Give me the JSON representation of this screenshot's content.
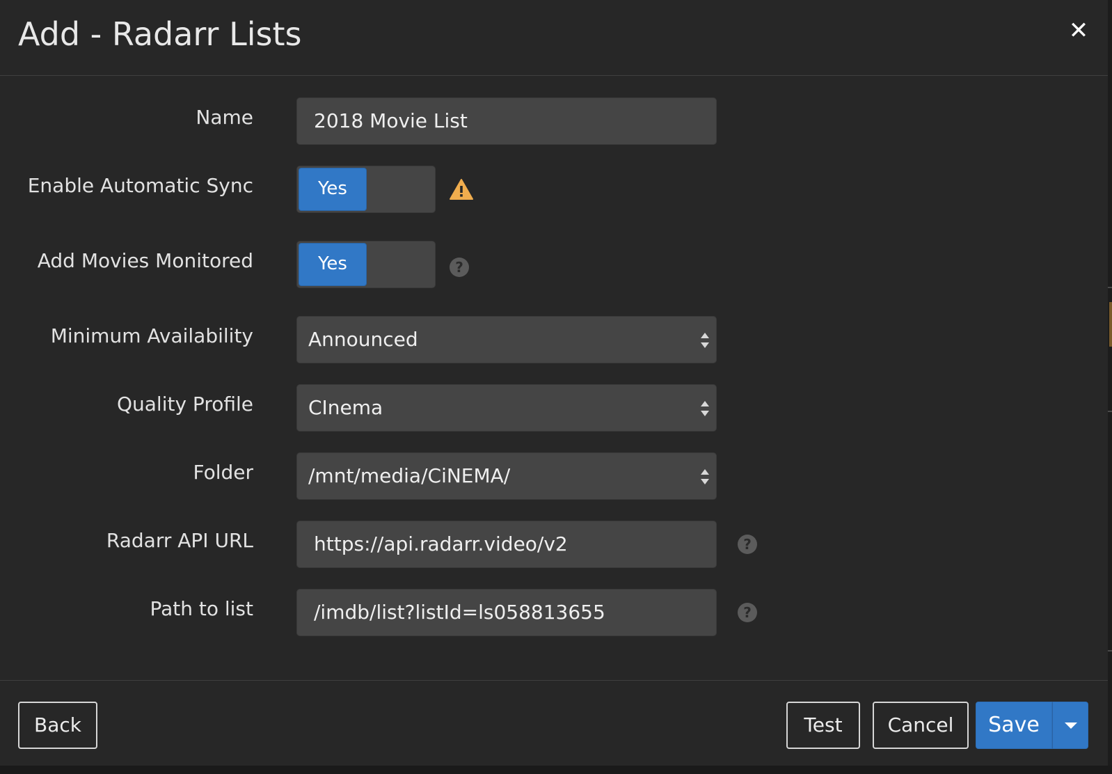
{
  "modal": {
    "title": "Add - Radarr Lists",
    "close_icon": "close-icon"
  },
  "form": {
    "name": {
      "label": "Name",
      "value": "2018 Movie List"
    },
    "enable_automatic_sync": {
      "label": "Enable Automatic Sync",
      "value": "Yes",
      "icon": "warning-icon"
    },
    "add_movies_monitored": {
      "label": "Add Movies Monitored",
      "value": "Yes",
      "icon": "help-icon"
    },
    "minimum_availability": {
      "label": "Minimum Availability",
      "value": "Announced"
    },
    "quality_profile": {
      "label": "Quality Profile",
      "value": "CInema"
    },
    "folder": {
      "label": "Folder",
      "value": "/mnt/media/CiNEMA/"
    },
    "radarr_api_url": {
      "label": "Radarr API URL",
      "value": "https://api.radarr.video/v2",
      "icon": "help-icon"
    },
    "path_to_list": {
      "label": "Path to list",
      "value": "/imdb/list?listId=ls058813655",
      "icon": "help-icon"
    }
  },
  "footer": {
    "back_label": "Back",
    "test_label": "Test",
    "cancel_label": "Cancel",
    "save_label": "Save"
  },
  "colors": {
    "accent": "#3178c6",
    "warning": "#f0ad4e",
    "background": "#272727",
    "input": "#454545"
  }
}
